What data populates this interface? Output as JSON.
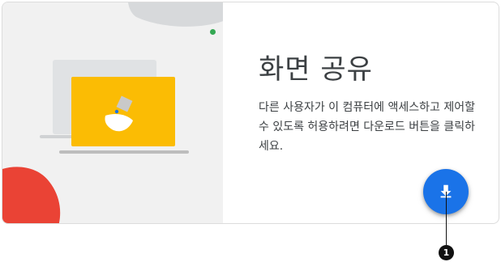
{
  "share_panel": {
    "title": "화면 공유",
    "description": "다른 사용자가 이 컴퓨터에 액세스하고 제어할 수 있도록 허용하려면 다운로드 버튼을 클릭하세요.",
    "download_icon": "download-icon"
  },
  "annotation": {
    "number": "1"
  },
  "colors": {
    "accent_blue": "#1a73e8",
    "illustration_yellow": "#fbbc04",
    "illustration_red": "#ea4335",
    "status_green": "#34a853"
  }
}
